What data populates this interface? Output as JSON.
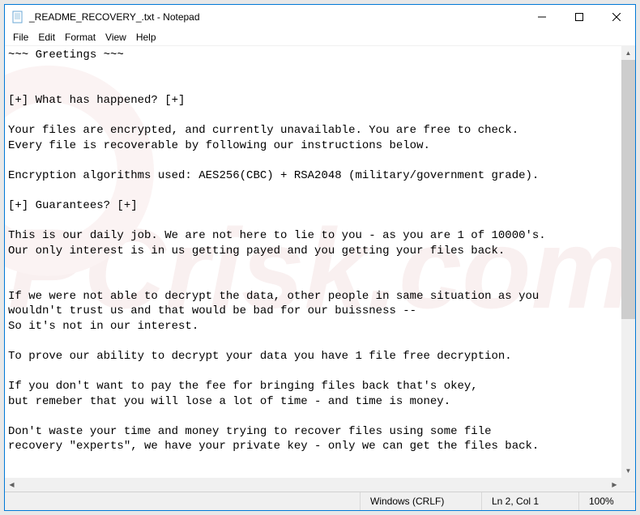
{
  "window": {
    "title": "_README_RECOVERY_.txt - Notepad"
  },
  "menu": {
    "file": "File",
    "edit": "Edit",
    "format": "Format",
    "view": "View",
    "help": "Help"
  },
  "document": {
    "lines": [
      "~~~ Greetings ~~~",
      "",
      "",
      "[+] What has happened? [+]",
      "",
      "Your files are encrypted, and currently unavailable. You are free to check.",
      "Every file is recoverable by following our instructions below.",
      "",
      "Encryption algorithms used: AES256(CBC) + RSA2048 (military/government grade).",
      "",
      "[+] Guarantees? [+]",
      "",
      "This is our daily job. We are not here to lie to you - as you are 1 of 10000's.",
      "Our only interest is in us getting payed and you getting your files back.",
      "",
      "",
      "If we were not able to decrypt the data, other people in same situation as you",
      "wouldn't trust us and that would be bad for our buissness --",
      "So it's not in our interest.",
      "",
      "To prove our ability to decrypt your data you have 1 file free decryption.",
      "",
      "If you don't want to pay the fee for bringing files back that's okey,",
      "but remeber that you will lose a lot of time - and time is money.",
      "",
      "Don't waste your time and money trying to recover files using some file",
      "recovery \"experts\", we have your private key - only we can get the files back."
    ]
  },
  "statusbar": {
    "encoding": "Windows (CRLF)",
    "position": "Ln 2, Col 1",
    "zoom": "100%"
  },
  "watermark": {
    "text": "PCrisk.com"
  }
}
